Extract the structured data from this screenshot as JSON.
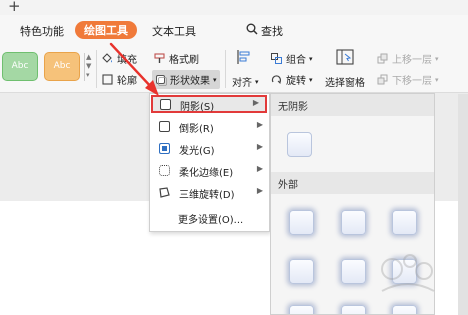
{
  "app": {
    "new_tab_symbol": "+"
  },
  "tabs": [
    {
      "label": "特色功能",
      "active": false
    },
    {
      "label": "绘图工具",
      "active": true
    },
    {
      "label": "文本工具",
      "active": false
    },
    {
      "label": "查找",
      "active": false
    }
  ],
  "ribbon": {
    "styles": [
      "Abc",
      "Abc"
    ],
    "fill": "填充",
    "format_painter": "格式刷",
    "outline": "轮廓",
    "shape_effects": "形状效果",
    "align": "对齐",
    "group": "组合",
    "rotate": "旋转",
    "selection_pane": "选择窗格",
    "bring_forward": "上移一层",
    "send_backward": "下移一层"
  },
  "effects_menu": {
    "items": [
      {
        "label": "阴影(S)",
        "icon": "shadow-icon",
        "has_submenu": true,
        "highlighted": true
      },
      {
        "label": "倒影(R)",
        "icon": "reflection-icon",
        "has_submenu": true,
        "highlighted": false
      },
      {
        "label": "发光(G)",
        "icon": "glow-icon",
        "has_submenu": true,
        "highlighted": false
      },
      {
        "label": "柔化边缘(E)",
        "icon": "soft-edges-icon",
        "has_submenu": true,
        "highlighted": false
      },
      {
        "label": "三维旋转(D)",
        "icon": "3d-rotation-icon",
        "has_submenu": true,
        "highlighted": false
      }
    ],
    "more_settings": "更多设置(O)..."
  },
  "shadow_submenu": {
    "no_shadow_label": "无阴影",
    "outer_label": "外部"
  },
  "colors": {
    "active_tab": "#f07a3a",
    "highlight_border": "#e23a3a",
    "annotation_arrow": "#e8322c"
  }
}
